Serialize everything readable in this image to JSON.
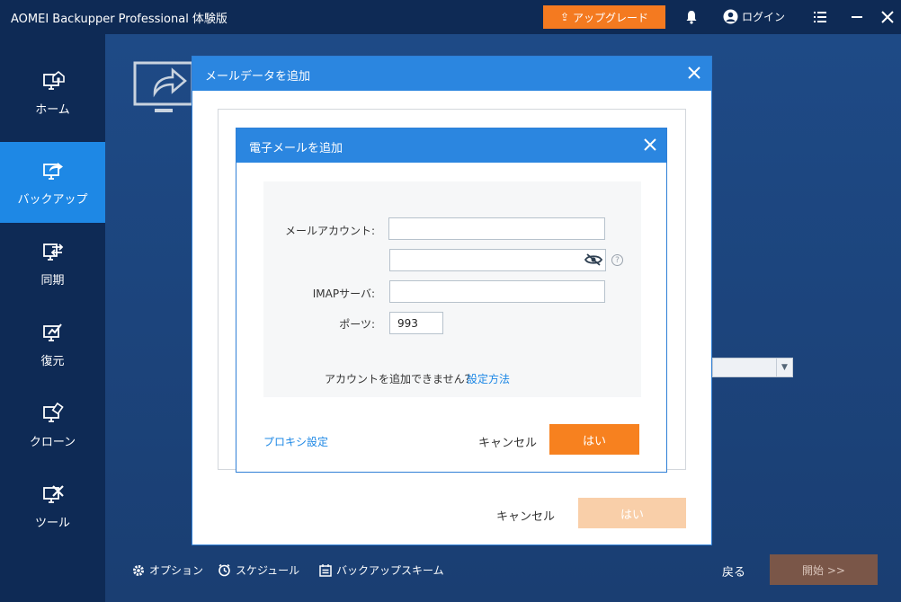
{
  "titlebar": {
    "title": "AOMEI Backupper Professional 体験版",
    "upgrade_label": "アップグレード",
    "login_label": "ログイン"
  },
  "sidebar": {
    "items": [
      {
        "label": "ホーム",
        "icon": "home-icon"
      },
      {
        "label": "バックアップ",
        "icon": "backup-icon"
      },
      {
        "label": "同期",
        "icon": "sync-icon"
      },
      {
        "label": "復元",
        "icon": "restore-icon"
      },
      {
        "label": "クローン",
        "icon": "clone-icon"
      },
      {
        "label": "ツール",
        "icon": "tools-icon"
      }
    ],
    "active_index": 1
  },
  "bottom_bar": {
    "options_label": "オプション",
    "schedule_label": "スケジュール",
    "scheme_label": "バックアップスキーム",
    "back_label": "戻る",
    "start_label": "開始 >>"
  },
  "outer_dialog": {
    "title": "メールデータを追加",
    "cancel_label": "キャンセル",
    "yes_label": "はい"
  },
  "inner_dialog": {
    "title": "電子メールを追加",
    "account_label": "メールアカウント:",
    "account_value": "",
    "password_value": "",
    "imap_label": "IMAPサーバ:",
    "imap_value": "",
    "port_label": "ポーツ:",
    "port_value": "993",
    "cant_add_text": "アカウントを追加できません？",
    "how_to_link": "設定方法",
    "proxy_link": "プロキシ設定",
    "cancel_label": "キャンセル",
    "yes_label": "はい"
  },
  "colors": {
    "accent_orange": "#f7811f",
    "accent_blue": "#2b86e0",
    "sidebar_bg": "#0e2a55",
    "active_nav": "#1e88e5"
  }
}
